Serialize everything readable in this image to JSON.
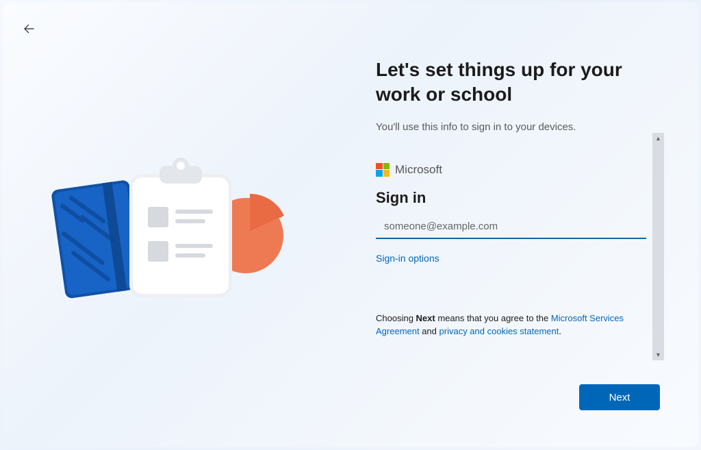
{
  "header": {
    "title": "Let's set things up for your work or school",
    "subtitle": "You'll use this info to sign in to your devices."
  },
  "brand": {
    "name": "Microsoft"
  },
  "signin": {
    "title": "Sign in",
    "placeholder": "someone@example.com",
    "value": "",
    "options_label": "Sign-in options"
  },
  "legal": {
    "prefix": "Choosing ",
    "bold": "Next",
    "mid": " means that you agree to the ",
    "agreement_link": "Microsoft Services Agreement",
    "and": " and ",
    "privacy_link": "privacy and cookies statement",
    "suffix": "."
  },
  "buttons": {
    "next": "Next"
  },
  "colors": {
    "accent": "#0067B8"
  }
}
